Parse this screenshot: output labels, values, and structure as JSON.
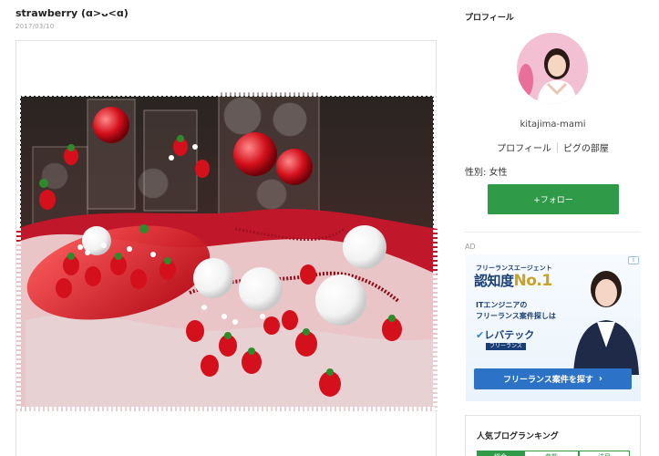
{
  "post": {
    "title": "strawberry (ɑ>ᴗ<ɑ)",
    "date": "2017/03/10"
  },
  "sidebar": {
    "heading": "プロフィール",
    "username": "kitajima-mami",
    "links": [
      "プロフィール",
      "ピグの部屋"
    ],
    "gender": "性別: 女性",
    "follow_label": "+フォロー",
    "ad_label": "AD"
  },
  "ad": {
    "corner": "i",
    "line1": "フリーランスエージェント",
    "line2_prefix": "認知度",
    "line2_rank": "No.1",
    "line3a": "ITエンジニアの",
    "line3b": "フリーランス案件探しは",
    "logo": "レバテック",
    "sublogo": "フリーランス",
    "cta": "フリーランス案件を探す",
    "cta_arrow": "›"
  },
  "ranking": {
    "title": "人気ブログランキング",
    "tabs": [
      "総合",
      "芸能",
      "注目"
    ]
  },
  "colors": {
    "follow_green": "#2f9a48",
    "ad_blue": "#2c73c8",
    "ad_navy": "#1a3f77"
  }
}
